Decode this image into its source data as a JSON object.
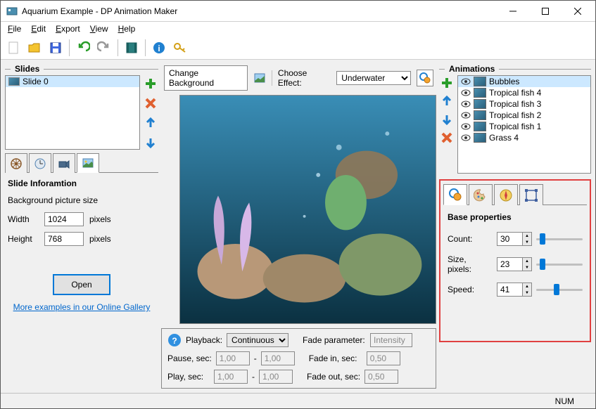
{
  "title": "Aquarium Example - DP Animation Maker",
  "menu": [
    "File",
    "Edit",
    "Export",
    "View",
    "Help"
  ],
  "slides_head": "Slides",
  "slides": [
    {
      "name": "Slide 0"
    }
  ],
  "slide_info": {
    "title": "Slide Inforamtion",
    "bg_label": "Background picture size",
    "width_label": "Width",
    "width": "1024",
    "height_label": "Height",
    "height": "768",
    "px": "pixels",
    "open": "Open",
    "gallery": "More examples in our Online Gallery"
  },
  "center": {
    "change_bg": "Change Background",
    "choose_effect": "Choose Effect:",
    "effect": "Underwater"
  },
  "playback": {
    "label": "Playback:",
    "mode": "Continuous",
    "pause_label": "Pause, sec:",
    "pause_a": "1,00",
    "pause_b": "1,00",
    "play_label": "Play, sec:",
    "play_a": "1,00",
    "play_b": "1,00",
    "fade_param_label": "Fade parameter:",
    "fade_param": "Intensity",
    "fade_in_label": "Fade in, sec:",
    "fade_in": "0,50",
    "fade_out_label": "Fade out, sec:",
    "fade_out": "0,50"
  },
  "anim_head": "Animations",
  "animations": [
    {
      "name": "Bubbles",
      "sel": true
    },
    {
      "name": "Tropical fish 4"
    },
    {
      "name": "Tropical fish 3"
    },
    {
      "name": "Tropical fish 2"
    },
    {
      "name": "Tropical fish 1"
    },
    {
      "name": "Grass 4"
    }
  ],
  "props": {
    "title": "Base properties",
    "count_label": "Count:",
    "count": "30",
    "size_label": "Size, pixels:",
    "size": "23",
    "speed_label": "Speed:",
    "speed": "41"
  },
  "status": "NUM"
}
